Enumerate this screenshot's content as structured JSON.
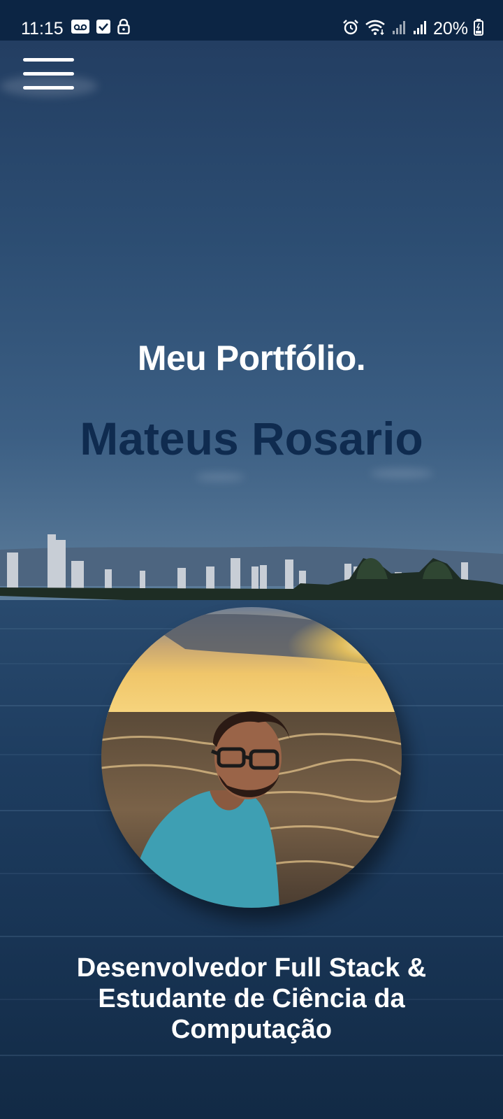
{
  "status_bar": {
    "time": "11:15",
    "left_icons": [
      "voicemail-icon",
      "checkbox-icon",
      "lock-icon"
    ],
    "right_icons": [
      "alarm-icon",
      "wifi-icon",
      "signal-icon",
      "signal-icon"
    ],
    "battery": "20%"
  },
  "header": {
    "menu_icon": "hamburger-menu-icon"
  },
  "hero": {
    "title": "Meu Portfólio.",
    "name": "Mateus Rosario",
    "subtitle": "Desenvolvedor Full Stack & Estudante de Ciência da Computação"
  },
  "colors": {
    "status_bar": "#0c2544",
    "name_text": "#0f2b4f",
    "title_text": "#ffffff"
  }
}
